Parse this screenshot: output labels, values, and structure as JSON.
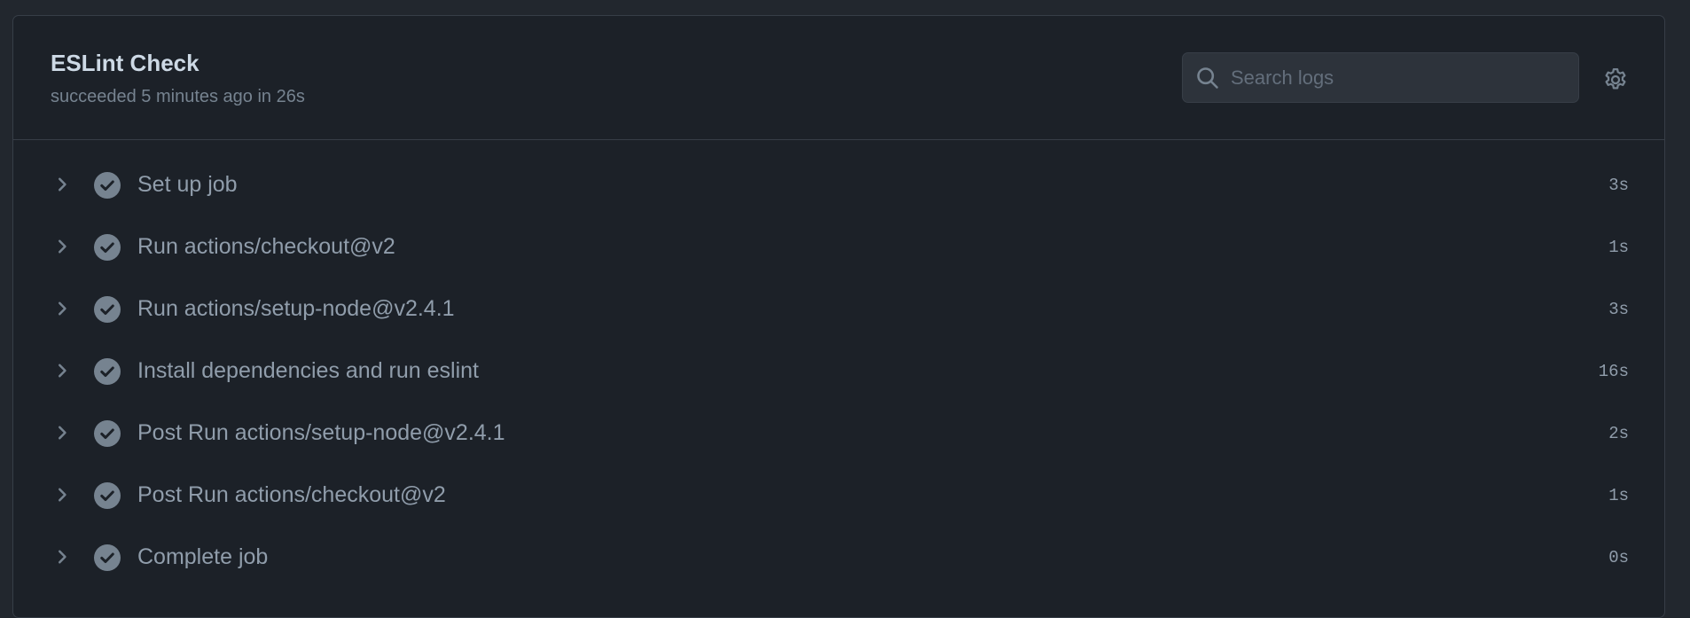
{
  "job": {
    "title": "ESLint Check",
    "status": "succeeded 5 minutes ago in 26s"
  },
  "search": {
    "placeholder": "Search logs",
    "value": ""
  },
  "icons": {
    "search": "search-icon",
    "settings": "gear-icon",
    "expand": "chevron-right-icon",
    "success": "check-circle-icon"
  },
  "colors": {
    "background": "#22272e",
    "panel": "#1c2128",
    "border": "#373e47",
    "title": "#cdd9e5",
    "muted": "#768390",
    "step_text": "#909dab",
    "check_fill": "#768390"
  },
  "steps": [
    {
      "label": "Set up job",
      "duration": "3s",
      "status": "success"
    },
    {
      "label": "Run actions/checkout@v2",
      "duration": "1s",
      "status": "success"
    },
    {
      "label": "Run actions/setup-node@v2.4.1",
      "duration": "3s",
      "status": "success"
    },
    {
      "label": "Install dependencies and run eslint",
      "duration": "16s",
      "status": "success"
    },
    {
      "label": "Post Run actions/setup-node@v2.4.1",
      "duration": "2s",
      "status": "success"
    },
    {
      "label": "Post Run actions/checkout@v2",
      "duration": "1s",
      "status": "success"
    },
    {
      "label": "Complete job",
      "duration": "0s",
      "status": "success"
    }
  ]
}
